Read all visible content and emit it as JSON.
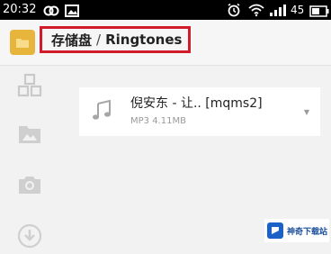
{
  "status_bar": {
    "time": "20:32",
    "battery": "45",
    "icons": [
      "loop-icon",
      "image-icon",
      "alarm-icon",
      "wifi-icon",
      "signal-icon",
      "battery-icon"
    ]
  },
  "header": {
    "folder_icon": "folder-icon",
    "breadcrumb": {
      "root": "存储盘",
      "separator": "/",
      "current": "Ringtones"
    },
    "highlight_color": "#d01c2a"
  },
  "sidebar": {
    "items": [
      {
        "icon": "category-icon"
      },
      {
        "icon": "image-folder-icon"
      },
      {
        "icon": "camera-icon"
      },
      {
        "icon": "download-icon"
      }
    ]
  },
  "files": [
    {
      "name": "倪安东 - 让.. [mqms2]",
      "meta": "MP3 4.11MB",
      "icon": "music-note-icon"
    }
  ],
  "watermark": {
    "text": "神奇下载站",
    "color": "#1a4f9c"
  }
}
